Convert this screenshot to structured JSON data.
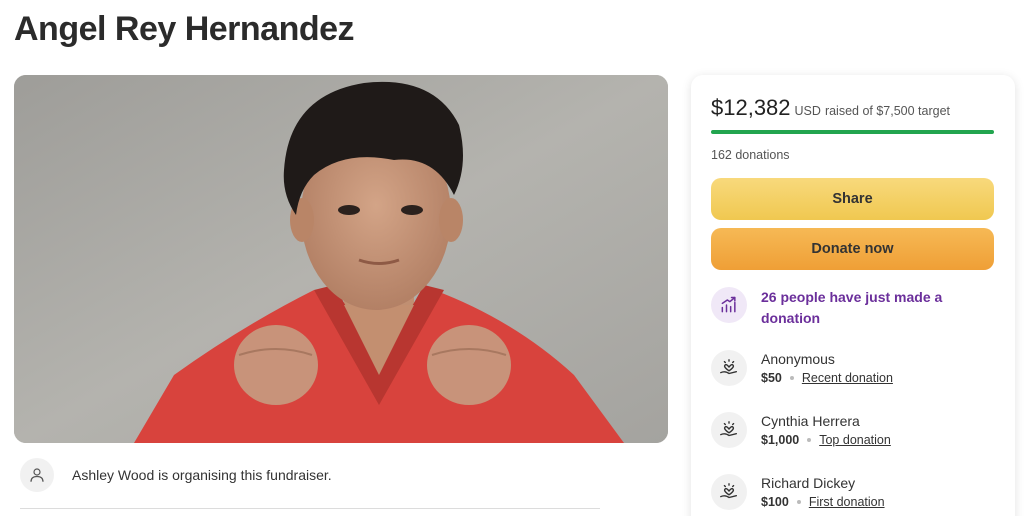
{
  "page": {
    "title": "Angel Rey Hernandez"
  },
  "organiser": {
    "text": "Ashley Wood is organising this fundraiser."
  },
  "progress": {
    "amount": "$12,382",
    "currency": "USD",
    "target_text": "raised of $7,500 target",
    "fraction": 1.0,
    "donations_text": "162 donations",
    "bar_color": "#22a54f"
  },
  "buttons": {
    "share": "Share",
    "donate": "Donate now"
  },
  "trend": {
    "text": "26 people have just made a donation",
    "color": "#6b2f9b"
  },
  "donors": [
    {
      "name": "Anonymous",
      "amount": "$50",
      "tag": "Recent donation"
    },
    {
      "name": "Cynthia Herrera",
      "amount": "$1,000",
      "tag": "Top donation"
    },
    {
      "name": "Richard Dickey",
      "amount": "$100",
      "tag": "First donation"
    }
  ],
  "icons": {
    "organiser": "person-icon",
    "trend": "trending-up-icon",
    "donor": "heart-hand-icon"
  }
}
